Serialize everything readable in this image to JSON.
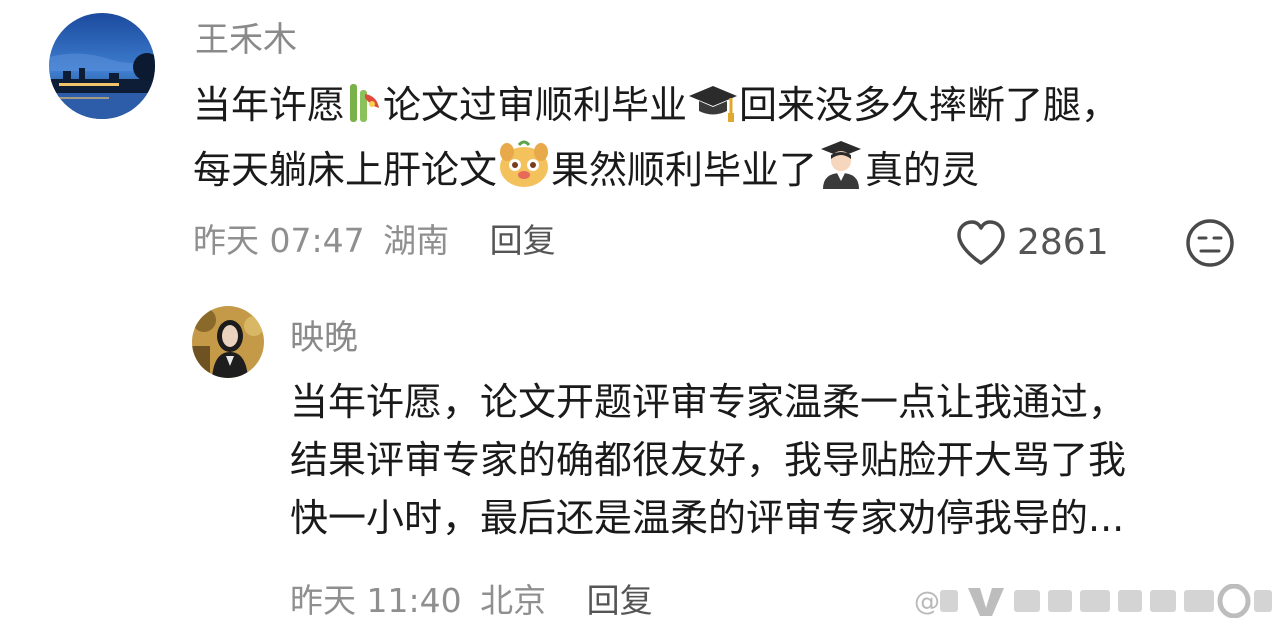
{
  "comment": {
    "username": "王禾木",
    "lines": [
      {
        "a": "当年许愿",
        "b": "论文过审顺利毕业",
        "c": "回来没多久摔断了腿，"
      },
      {
        "a": "每天躺床上肝论文",
        "b": "果然顺利毕业了",
        "c": "真的灵"
      }
    ],
    "emojis": [
      "bamboo-icon",
      "graduation-cap-icon",
      "dog-face-icon",
      "student-icon"
    ],
    "time": "昨天 07:47",
    "location": "湖南",
    "reply_label": "回复",
    "like_count": "2861"
  },
  "reply": {
    "username": "映晚",
    "lines": [
      "当年许愿，论文开题评审专家温柔一点让我通过，",
      "结果评审专家的确都很友好，我导贴脸开大骂了我",
      "快一小时，最后还是温柔的评审专家劝停我导的..."
    ],
    "time": "昨天 11:40",
    "location": "北京",
    "reply_label": "回复"
  },
  "watermark": "@"
}
